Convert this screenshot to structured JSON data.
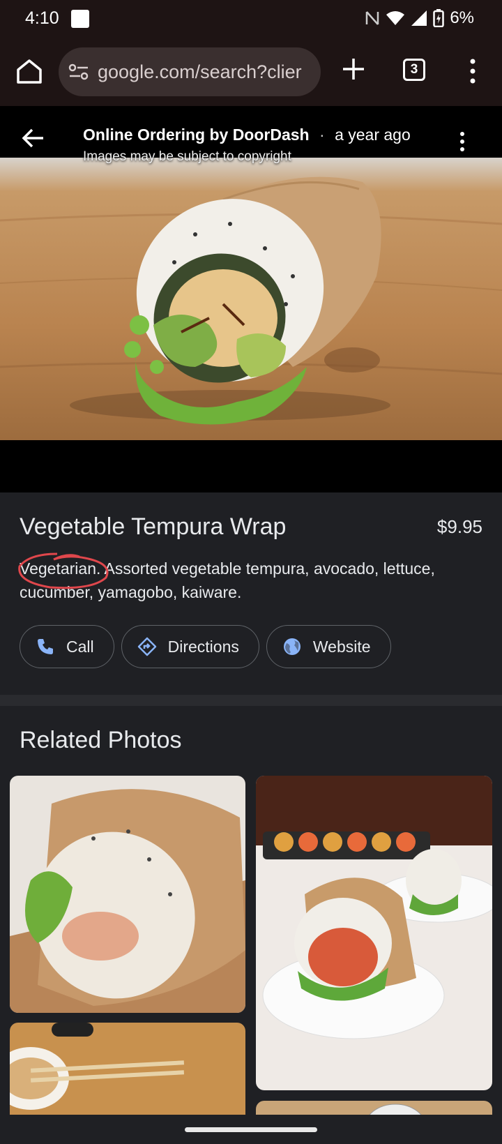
{
  "status_bar": {
    "time": "4:10",
    "battery": "6%"
  },
  "browser": {
    "url": "google.com/search?clier",
    "tab_count": "3"
  },
  "viewer": {
    "source": "Online Ordering by DoorDash",
    "separator": "·",
    "age": "a year ago",
    "copyright": "Images may be subject to copyright"
  },
  "detail": {
    "title": "Vegetable Tempura Wrap",
    "price": "$9.95",
    "description": "Vegetarian. Assorted vegetable tempura, avocado, lettuce, cucumber, yamagobo, kaiware.",
    "actions": [
      {
        "label": "Call",
        "icon": "phone-icon"
      },
      {
        "label": "Directions",
        "icon": "directions-icon"
      },
      {
        "label": "Website",
        "icon": "globe-icon"
      }
    ],
    "accent_color": "#8ab4f8",
    "annotation_color": "#e0474c"
  },
  "related": {
    "title": "Related Photos"
  }
}
